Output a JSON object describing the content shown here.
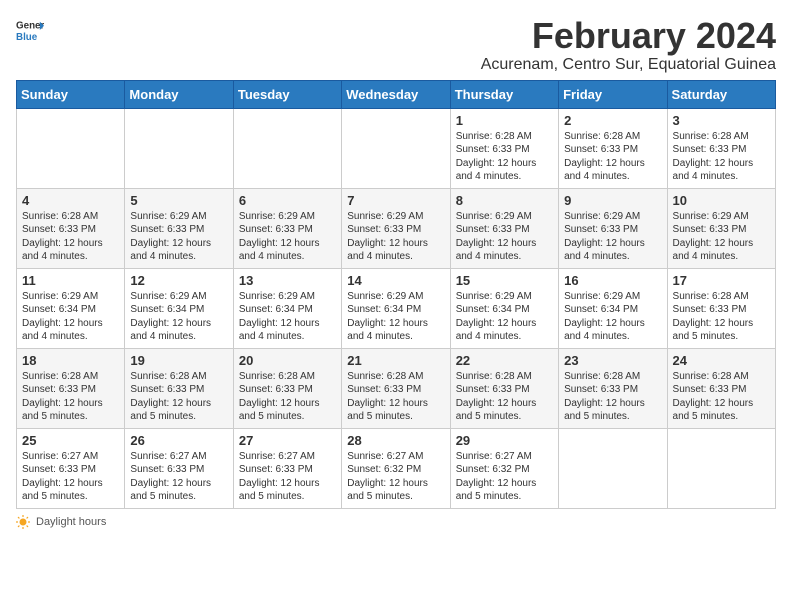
{
  "header": {
    "logo_general": "General",
    "logo_blue": "Blue",
    "main_title": "February 2024",
    "sub_title": "Acurenam, Centro Sur, Equatorial Guinea"
  },
  "days_of_week": [
    "Sunday",
    "Monday",
    "Tuesday",
    "Wednesday",
    "Thursday",
    "Friday",
    "Saturday"
  ],
  "weeks": [
    [
      {
        "day": "",
        "info": ""
      },
      {
        "day": "",
        "info": ""
      },
      {
        "day": "",
        "info": ""
      },
      {
        "day": "",
        "info": ""
      },
      {
        "day": "1",
        "info": "Sunrise: 6:28 AM\nSunset: 6:33 PM\nDaylight: 12 hours\nand 4 minutes."
      },
      {
        "day": "2",
        "info": "Sunrise: 6:28 AM\nSunset: 6:33 PM\nDaylight: 12 hours\nand 4 minutes."
      },
      {
        "day": "3",
        "info": "Sunrise: 6:28 AM\nSunset: 6:33 PM\nDaylight: 12 hours\nand 4 minutes."
      }
    ],
    [
      {
        "day": "4",
        "info": "Sunrise: 6:28 AM\nSunset: 6:33 PM\nDaylight: 12 hours\nand 4 minutes."
      },
      {
        "day": "5",
        "info": "Sunrise: 6:29 AM\nSunset: 6:33 PM\nDaylight: 12 hours\nand 4 minutes."
      },
      {
        "day": "6",
        "info": "Sunrise: 6:29 AM\nSunset: 6:33 PM\nDaylight: 12 hours\nand 4 minutes."
      },
      {
        "day": "7",
        "info": "Sunrise: 6:29 AM\nSunset: 6:33 PM\nDaylight: 12 hours\nand 4 minutes."
      },
      {
        "day": "8",
        "info": "Sunrise: 6:29 AM\nSunset: 6:33 PM\nDaylight: 12 hours\nand 4 minutes."
      },
      {
        "day": "9",
        "info": "Sunrise: 6:29 AM\nSunset: 6:33 PM\nDaylight: 12 hours\nand 4 minutes."
      },
      {
        "day": "10",
        "info": "Sunrise: 6:29 AM\nSunset: 6:33 PM\nDaylight: 12 hours\nand 4 minutes."
      }
    ],
    [
      {
        "day": "11",
        "info": "Sunrise: 6:29 AM\nSunset: 6:34 PM\nDaylight: 12 hours\nand 4 minutes."
      },
      {
        "day": "12",
        "info": "Sunrise: 6:29 AM\nSunset: 6:34 PM\nDaylight: 12 hours\nand 4 minutes."
      },
      {
        "day": "13",
        "info": "Sunrise: 6:29 AM\nSunset: 6:34 PM\nDaylight: 12 hours\nand 4 minutes."
      },
      {
        "day": "14",
        "info": "Sunrise: 6:29 AM\nSunset: 6:34 PM\nDaylight: 12 hours\nand 4 minutes."
      },
      {
        "day": "15",
        "info": "Sunrise: 6:29 AM\nSunset: 6:34 PM\nDaylight: 12 hours\nand 4 minutes."
      },
      {
        "day": "16",
        "info": "Sunrise: 6:29 AM\nSunset: 6:34 PM\nDaylight: 12 hours\nand 4 minutes."
      },
      {
        "day": "17",
        "info": "Sunrise: 6:28 AM\nSunset: 6:33 PM\nDaylight: 12 hours\nand 5 minutes."
      }
    ],
    [
      {
        "day": "18",
        "info": "Sunrise: 6:28 AM\nSunset: 6:33 PM\nDaylight: 12 hours\nand 5 minutes."
      },
      {
        "day": "19",
        "info": "Sunrise: 6:28 AM\nSunset: 6:33 PM\nDaylight: 12 hours\nand 5 minutes."
      },
      {
        "day": "20",
        "info": "Sunrise: 6:28 AM\nSunset: 6:33 PM\nDaylight: 12 hours\nand 5 minutes."
      },
      {
        "day": "21",
        "info": "Sunrise: 6:28 AM\nSunset: 6:33 PM\nDaylight: 12 hours\nand 5 minutes."
      },
      {
        "day": "22",
        "info": "Sunrise: 6:28 AM\nSunset: 6:33 PM\nDaylight: 12 hours\nand 5 minutes."
      },
      {
        "day": "23",
        "info": "Sunrise: 6:28 AM\nSunset: 6:33 PM\nDaylight: 12 hours\nand 5 minutes."
      },
      {
        "day": "24",
        "info": "Sunrise: 6:28 AM\nSunset: 6:33 PM\nDaylight: 12 hours\nand 5 minutes."
      }
    ],
    [
      {
        "day": "25",
        "info": "Sunrise: 6:27 AM\nSunset: 6:33 PM\nDaylight: 12 hours\nand 5 minutes."
      },
      {
        "day": "26",
        "info": "Sunrise: 6:27 AM\nSunset: 6:33 PM\nDaylight: 12 hours\nand 5 minutes."
      },
      {
        "day": "27",
        "info": "Sunrise: 6:27 AM\nSunset: 6:33 PM\nDaylight: 12 hours\nand 5 minutes."
      },
      {
        "day": "28",
        "info": "Sunrise: 6:27 AM\nSunset: 6:32 PM\nDaylight: 12 hours\nand 5 minutes."
      },
      {
        "day": "29",
        "info": "Sunrise: 6:27 AM\nSunset: 6:32 PM\nDaylight: 12 hours\nand 5 minutes."
      },
      {
        "day": "",
        "info": ""
      },
      {
        "day": "",
        "info": ""
      }
    ]
  ],
  "footer": {
    "daylight_label": "Daylight hours"
  }
}
